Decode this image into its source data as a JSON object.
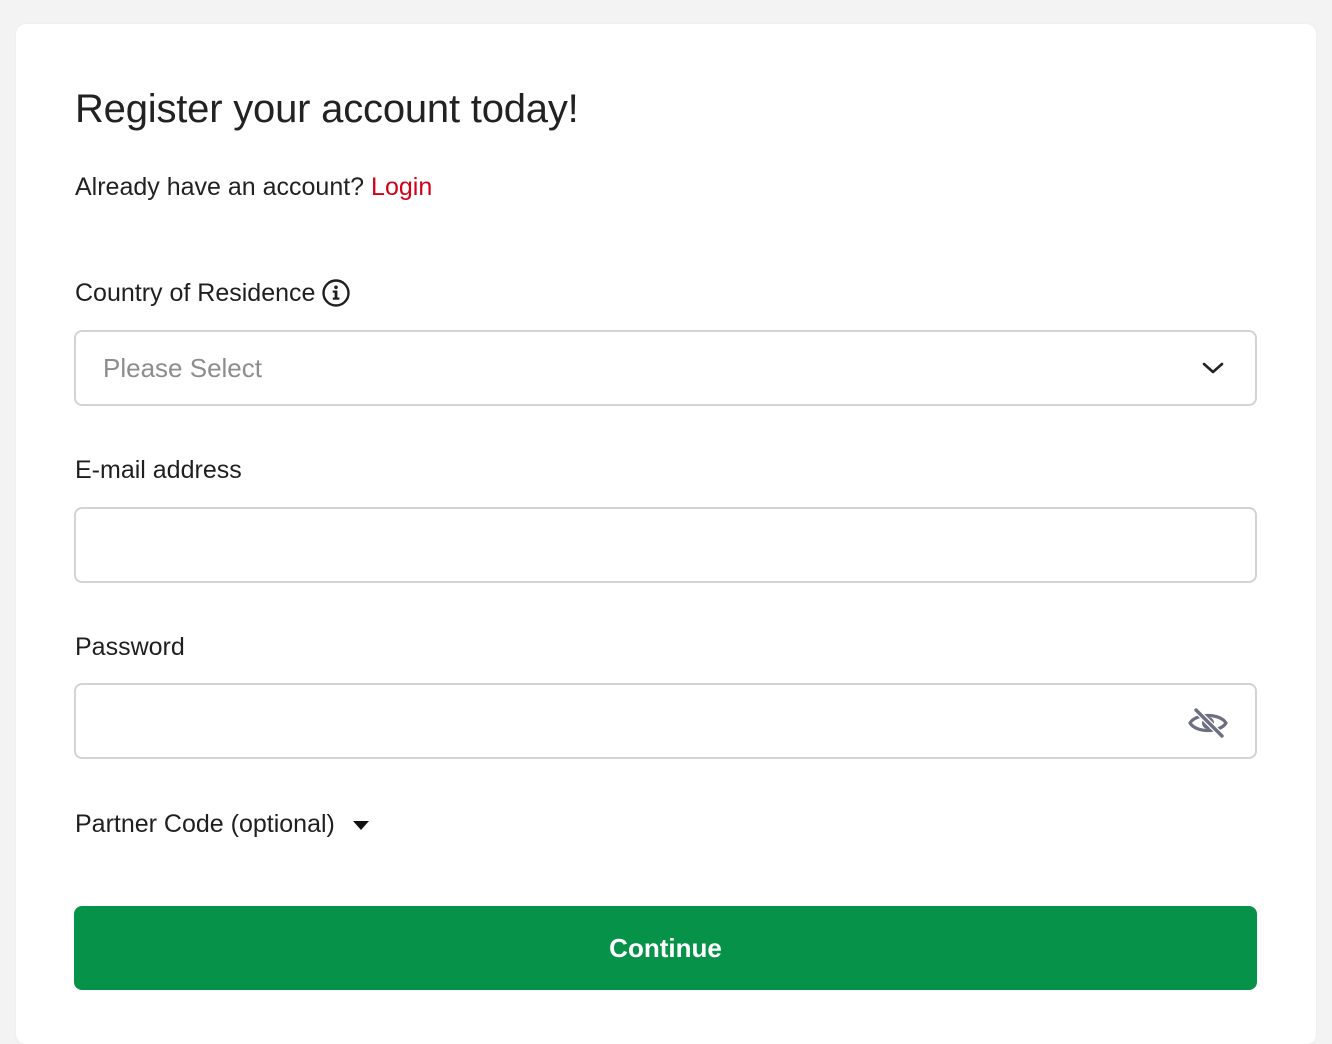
{
  "form": {
    "title": "Register your account today!",
    "login_prompt": "Already have an account?",
    "login_link": "Login",
    "country": {
      "label": "Country of Residence",
      "placeholder": "Please Select",
      "info_icon": "info-circle-icon",
      "dropdown_icon": "chevron-down-icon"
    },
    "email": {
      "label": "E-mail address",
      "value": ""
    },
    "password": {
      "label": "Password",
      "value": "",
      "visibility_icon": "eye-slash-icon"
    },
    "partner_code": {
      "label": "Partner Code (optional)",
      "toggle_icon": "caret-down-icon"
    },
    "continue_label": "Continue"
  },
  "colors": {
    "accent_link": "#d0021b",
    "button_bg": "#07924a",
    "page_bg": "#f3f3f3",
    "border": "#d3d3d3",
    "placeholder_text": "#8d8d8d"
  }
}
